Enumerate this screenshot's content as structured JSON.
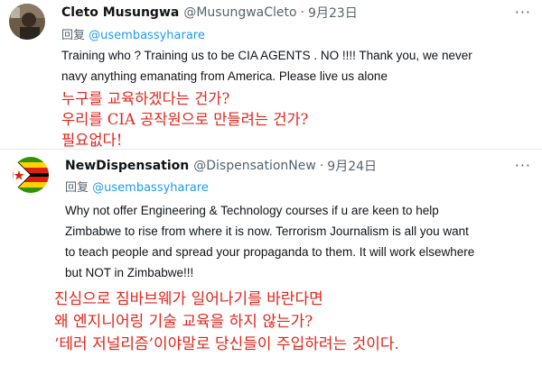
{
  "tweets": [
    {
      "name": "Cleto Musungwa",
      "handle": "@MusungwaCleto",
      "separator": "·",
      "date": "9月23日",
      "reply_prefix": "回复",
      "reply_mention": "@usembassyharare",
      "more": "···",
      "body_lines": [
        "Training who ? Training us to be CIA AGENTS . NO !!!! Thank you, we never",
        "navy anything emanating from America. Please live us alone"
      ],
      "translation_lines": [
        "누구를 교육하겠다는 건가?",
        "우리를 CIA 공작원으로 만들려는 건가?",
        "필요없다!"
      ]
    },
    {
      "name": "NewDispensation",
      "handle": "@DispensationNew",
      "separator": "·",
      "date": "9月24日",
      "reply_prefix": "回复",
      "reply_mention": "@usembassyharare",
      "more": "···",
      "body_lines": [
        "Why not offer Engineering & Technology courses if u are keen to help",
        "Zimbabwe to rise from where it is now. Terrorism Journalism is all you want",
        "to teach people and spread your propaganda to them. It will work elsewhere",
        "but NOT in Zimbabwe!!!"
      ],
      "translation_lines": [
        "진심으로 짐바브웨가 일어나기를 바란다면",
        "왜 엔지니어링 기술 교육을 하지 않는가?",
        "‘테러 저널리즘’이야말로 당신들이 주입하려는 것이다."
      ]
    }
  ]
}
